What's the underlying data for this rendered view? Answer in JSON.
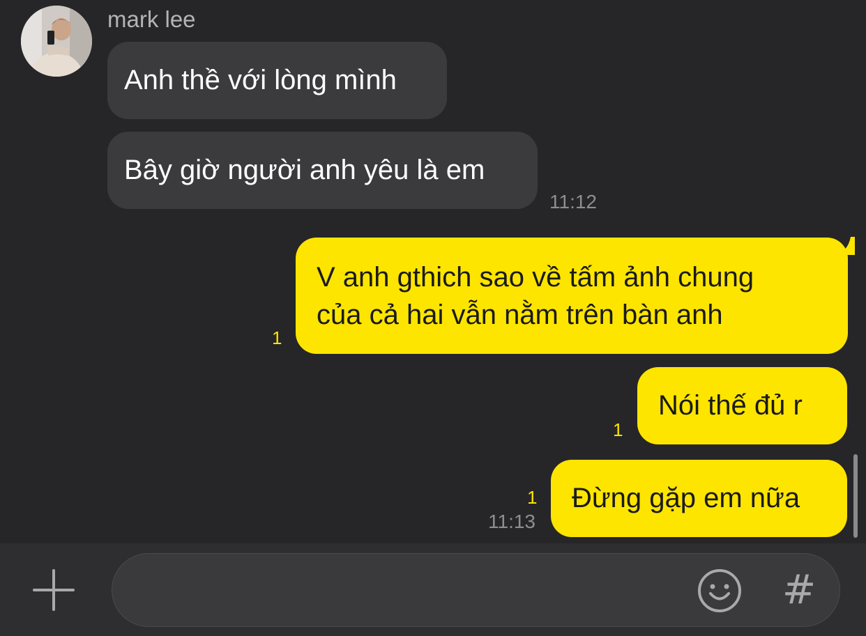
{
  "chat": {
    "sender_name": "mark lee",
    "incoming": [
      {
        "text": "Anh thề với lòng mình"
      },
      {
        "text": "Bây giờ người anh yêu là em",
        "time": "11:12"
      }
    ],
    "outgoing": [
      {
        "lines": [
          "V anh gthich sao về tấm ảnh chung",
          "của cả hai vẫn nằm trên bàn anh"
        ],
        "unread": "1"
      },
      {
        "text": "Nói thế đủ r",
        "unread": "1"
      },
      {
        "text": "Đừng gặp em nữa",
        "unread": "1",
        "time": "11:13"
      }
    ]
  },
  "composer": {
    "plus_icon": "plus-icon",
    "emoji_icon": "emoji-smiley-icon",
    "hash_label": "#",
    "input_value": ""
  },
  "colors": {
    "background": "#262628",
    "incoming_bubble": "#3b3b3d",
    "outgoing_bubble": "#fde500",
    "unread_count": "#fde500",
    "composer_bg": "#2e2e30"
  }
}
